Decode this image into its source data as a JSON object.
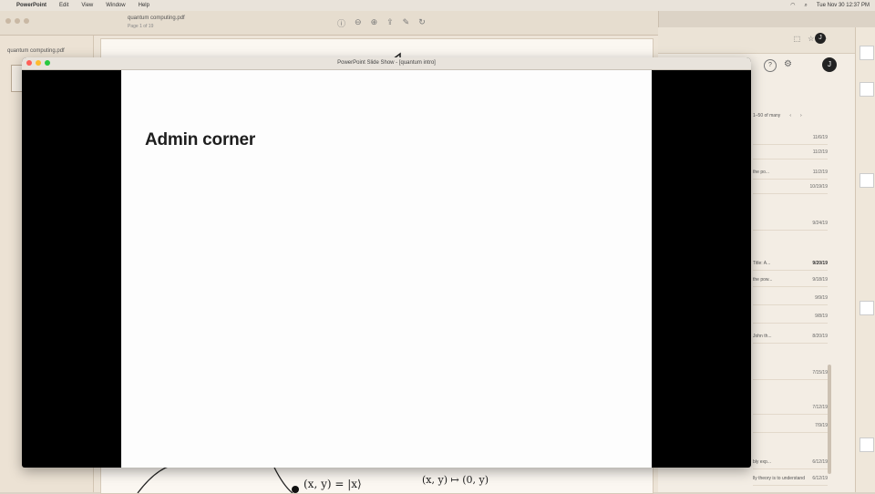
{
  "menubar": {
    "app": "PowerPoint",
    "items": [
      "Edit",
      "View",
      "Window",
      "Help"
    ],
    "clock": "Tue Nov 30 12:37 PM"
  },
  "pdf": {
    "window_title": "quantum computing.pdf",
    "window_subtitle": "Page 1 of 19",
    "sidebar_file": "quantum computing.pdf",
    "handwriting_1": "(x, y) = |x⟩",
    "handwriting_2": "(x, y) ↦ (0, y)"
  },
  "ppt": {
    "window_title": "PowerPoint Slide Show - [quantum intro]",
    "slide_heading": "Admin corner"
  },
  "gmail": {
    "pager_text": "1–50 of many",
    "rows": [
      {
        "snippet": "",
        "date": "11/6/19",
        "unread": false
      },
      {
        "snippet": "",
        "date": "11/2/19",
        "unread": false
      },
      {
        "snippet": "the po...",
        "date": "11/2/19",
        "unread": false
      },
      {
        "snippet": "",
        "date": "10/19/19",
        "unread": false
      },
      {
        "snippet": "",
        "date": "9/24/19",
        "unread": false
      },
      {
        "snippet": "Title: A...",
        "date": "9/20/19",
        "unread": true
      },
      {
        "snippet": "the pow...",
        "date": "9/18/19",
        "unread": false
      },
      {
        "snippet": "",
        "date": "9/9/19",
        "unread": false
      },
      {
        "snippet": "",
        "date": "9/8/19",
        "unread": false
      },
      {
        "snippet": "John th...",
        "date": "8/20/19",
        "unread": false
      },
      {
        "snippet": "",
        "date": "7/15/19",
        "unread": false
      },
      {
        "snippet": "",
        "date": "7/12/19",
        "unread": false
      },
      {
        "snippet": "",
        "date": "7/9/19",
        "unread": false
      },
      {
        "snippet": "bly exp...",
        "date": "6/12/19",
        "unread": false
      },
      {
        "snippet": "lly theory is to understand",
        "date": "6/12/19",
        "unread": false
      }
    ]
  },
  "colors": {
    "desktop": "#dcd3c6",
    "slide_bg": "#fdfdfd",
    "letterbox": "#000000",
    "close": "#ff5f57",
    "minimize": "#febc2e",
    "zoom": "#28c840"
  },
  "icons": [
    "apple-icon",
    "wifi-icon",
    "search-icon",
    "zoom-in-icon",
    "share-icon",
    "help-icon",
    "gear-icon",
    "chevron-left-icon",
    "chevron-right-icon"
  ]
}
